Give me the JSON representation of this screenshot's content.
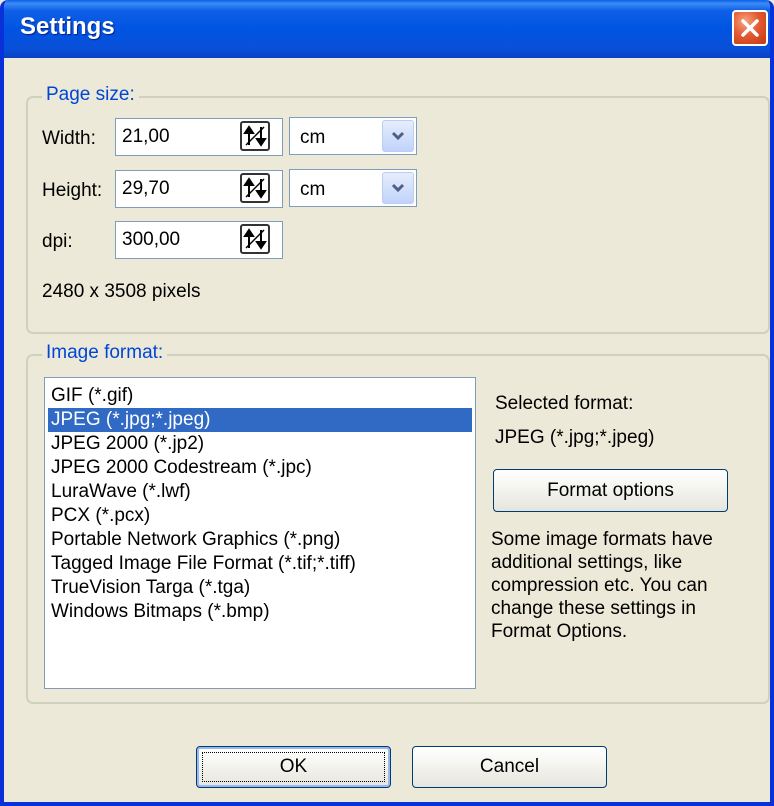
{
  "window": {
    "title": "Settings"
  },
  "page_size": {
    "legend": "Page size:",
    "width": {
      "label": "Width:",
      "value": "21,00",
      "unit": "cm"
    },
    "height": {
      "label": "Height:",
      "value": "29,70",
      "unit": "cm"
    },
    "dpi": {
      "label": "dpi:",
      "value": "300,00"
    },
    "pixels": "2480 x 3508 pixels"
  },
  "image_format": {
    "legend": "Image format:",
    "items": [
      "GIF (*.gif)",
      "JPEG (*.jpg;*.jpeg)",
      "JPEG 2000 (*.jp2)",
      "JPEG 2000 Codestream (*.jpc)",
      "LuraWave (*.lwf)",
      "PCX (*.pcx)",
      "Portable Network Graphics (*.png)",
      "Tagged Image File Format (*.tif;*.tiff)",
      "TrueVision Targa (*.tga)",
      "Windows Bitmaps (*.bmp)"
    ],
    "selected_index": 1,
    "selected_label": "Selected format:",
    "selected_value": "JPEG (*.jpg;*.jpeg)",
    "options_button": "Format options",
    "description": "Some image formats have additional settings, like compression etc. You can change these settings in Format Options."
  },
  "footer": {
    "ok": "OK",
    "cancel": "Cancel"
  },
  "colors": {
    "title_bar": "#0054e3",
    "selection": "#316ac5",
    "legend_text": "#0046d5",
    "close_button": "#e45a32"
  }
}
